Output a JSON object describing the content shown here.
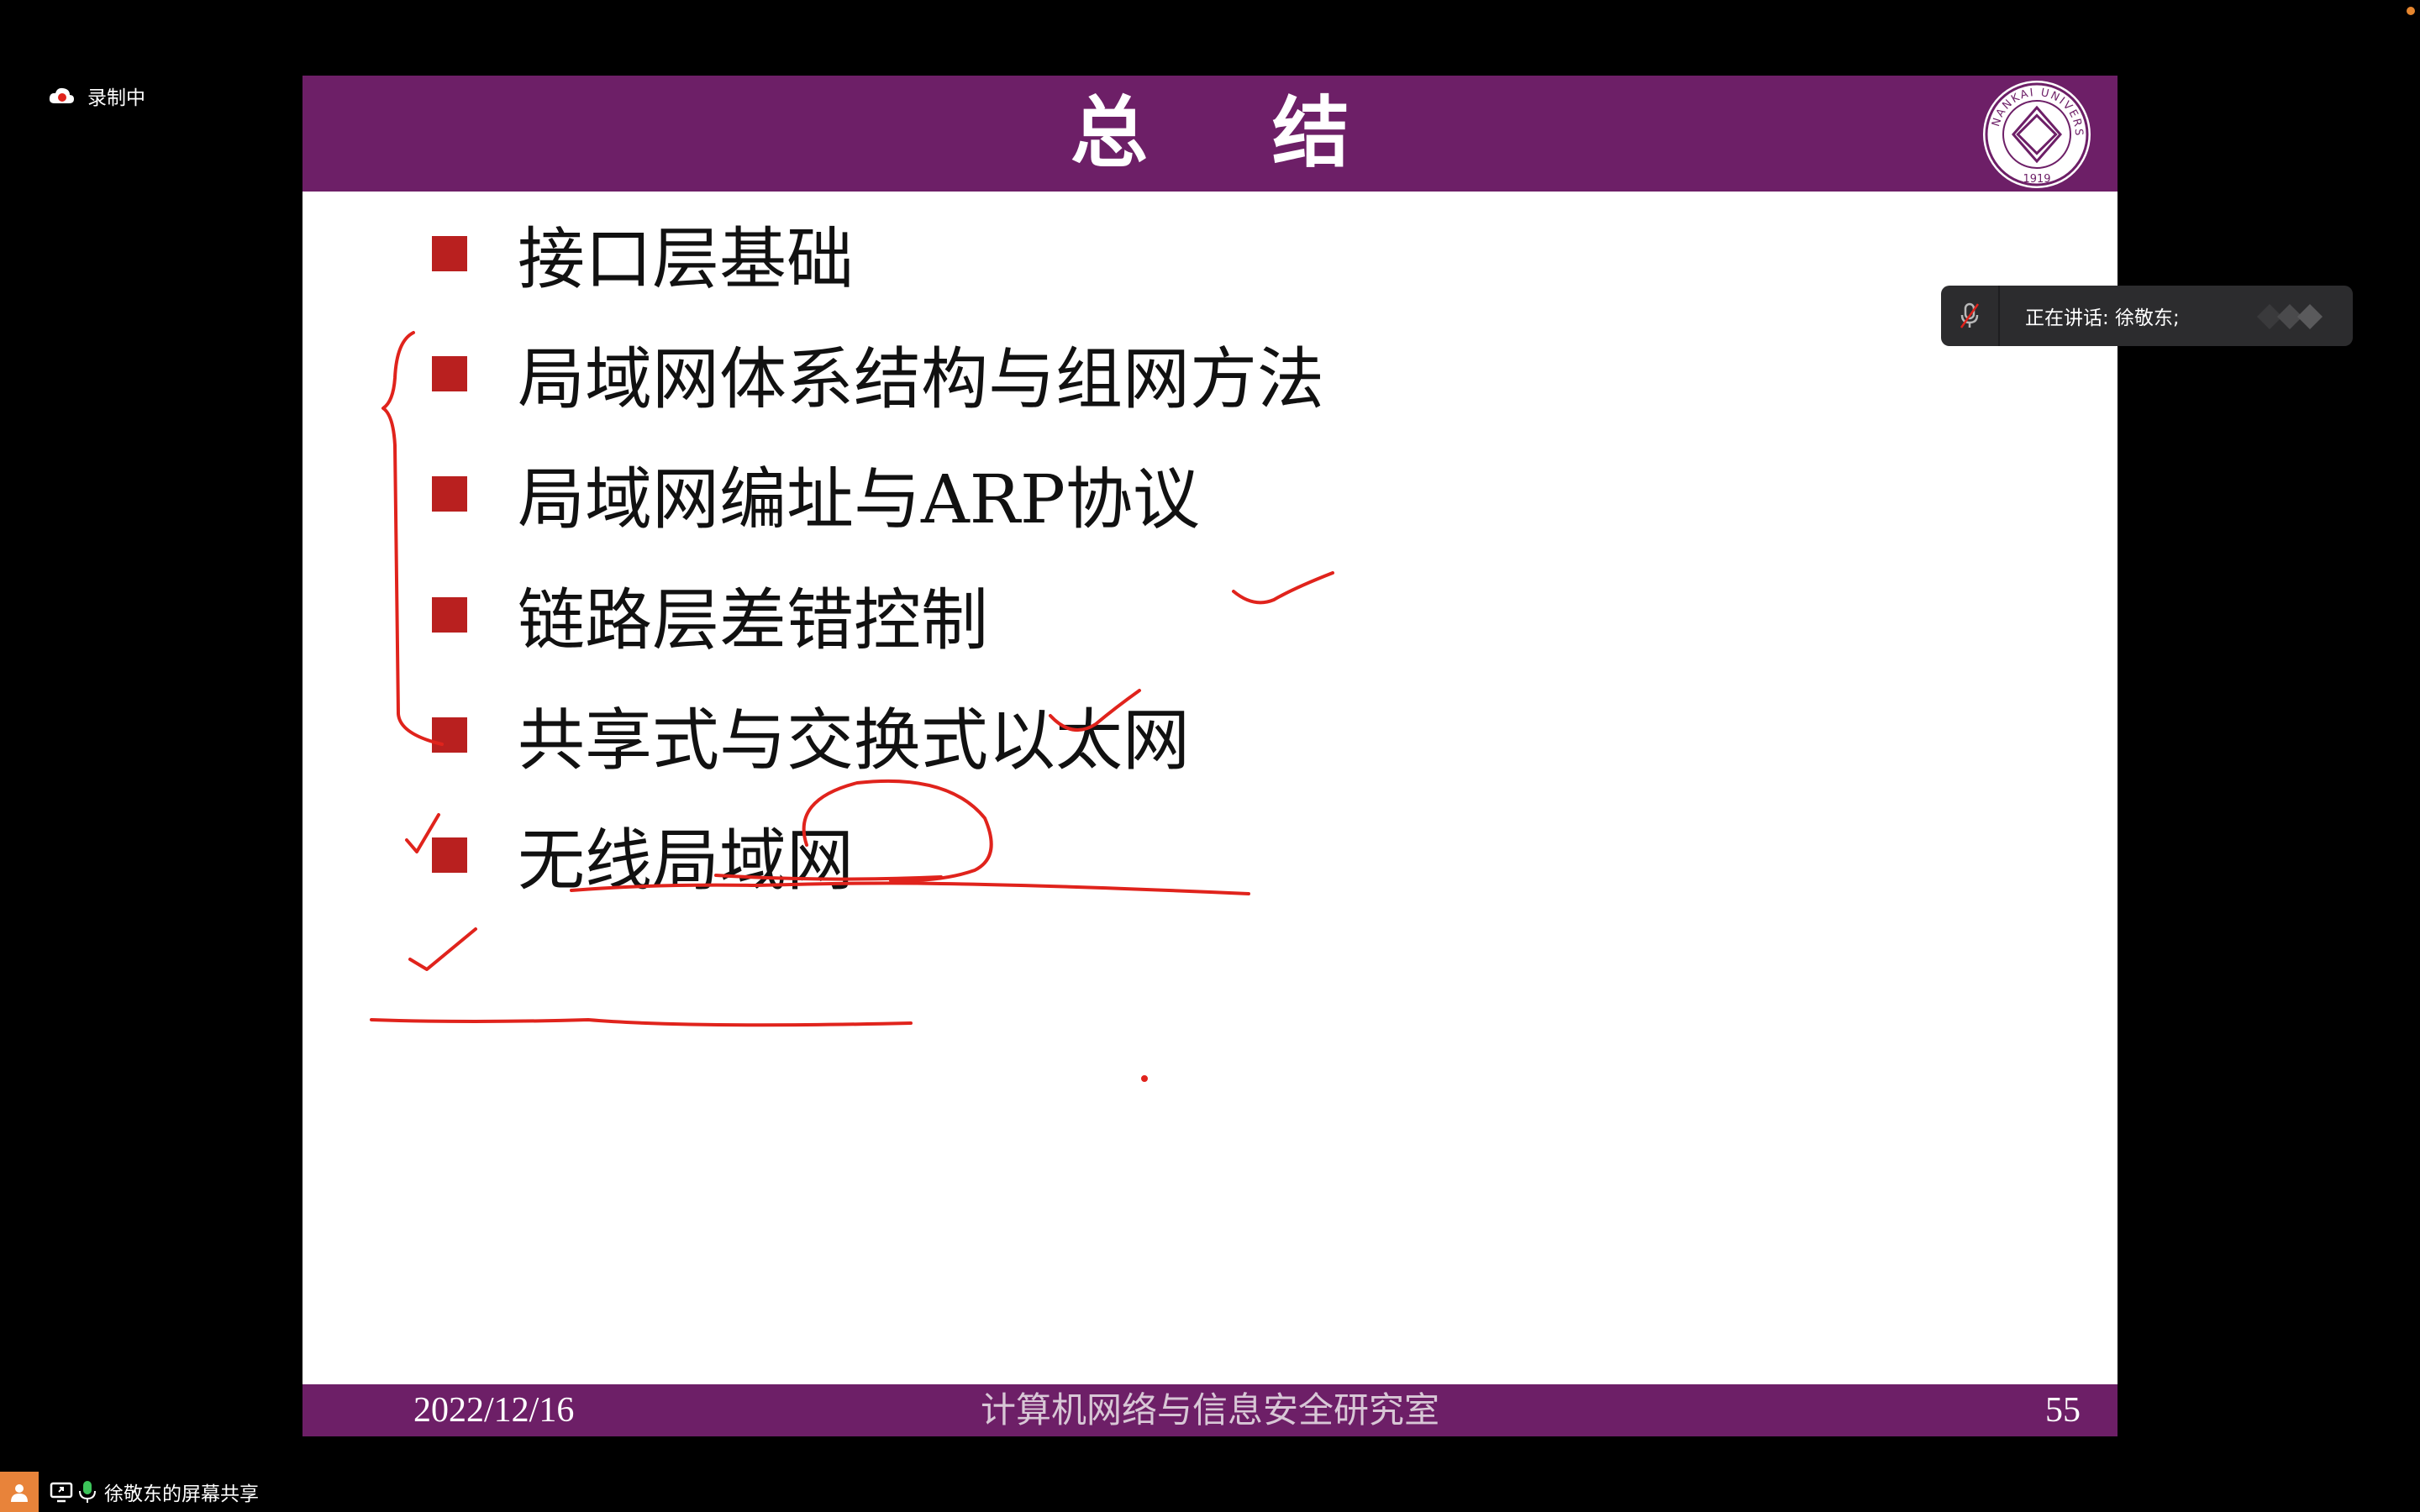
{
  "recording": {
    "label": "录制中"
  },
  "slide": {
    "title": "总 结",
    "bullets": [
      "接口层基础",
      "局域网体系结构与组网方法",
      "局域网编址与ARP协议",
      "链路层差错控制",
      "共享式与交换式以太网",
      "无线局域网"
    ],
    "footer": {
      "date": "2022/12/16",
      "lab": "计算机网络与信息安全研究室",
      "page": "55"
    },
    "seal": {
      "text": "NANKAI UNIVERSITY",
      "year": "1919"
    }
  },
  "toast": {
    "speaking": "正在讲话: 徐敬东;"
  },
  "bottom": {
    "share_label": "徐敬东的屏幕共享"
  },
  "colors": {
    "header": "#6d1f67",
    "bullet": "#b9201f",
    "ink": "#e0231c"
  }
}
